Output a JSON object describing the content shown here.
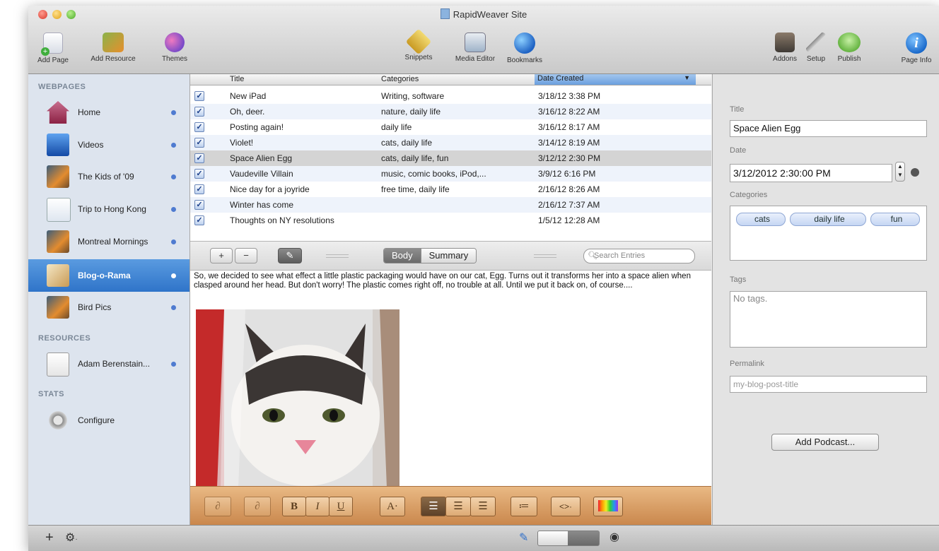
{
  "window": {
    "title": "RapidWeaver Site"
  },
  "toolbar": {
    "add_page": "Add Page",
    "add_resource": "Add Resource",
    "themes": "Themes",
    "snippets": "Snippets",
    "media_editor": "Media Editor",
    "bookmarks": "Bookmarks",
    "addons": "Addons",
    "setup": "Setup",
    "publish": "Publish",
    "page_info": "Page Info"
  },
  "sidebar": {
    "webpages_header": "WEBPAGES",
    "resources_header": "RESOURCES",
    "stats_header": "STATS",
    "pages": [
      {
        "label": "Home"
      },
      {
        "label": "Videos"
      },
      {
        "label": "The Kids of '09"
      },
      {
        "label": "Trip to Hong Kong"
      },
      {
        "label": "Montreal Mornings"
      },
      {
        "label": "Blog-o-Rama"
      },
      {
        "label": "Bird Pics"
      }
    ],
    "resources": [
      {
        "label": "Adam Berenstain..."
      }
    ],
    "stats": [
      {
        "label": "Configure"
      }
    ]
  },
  "table": {
    "columns": {
      "title": "Title",
      "categories": "Categories",
      "date": "Date Created"
    },
    "rows": [
      {
        "title": "New iPad",
        "categories": "Writing,  software",
        "date": "3/18/12 3:38 PM"
      },
      {
        "title": "Oh, deer.",
        "categories": "nature,  daily life",
        "date": "3/16/12 8:22 AM"
      },
      {
        "title": "Posting again!",
        "categories": "daily life",
        "date": "3/16/12 8:17 AM"
      },
      {
        "title": "Violet!",
        "categories": "cats,  daily life",
        "date": "3/14/12 8:19 AM"
      },
      {
        "title": "Space Alien Egg",
        "categories": "cats,  daily life,  fun",
        "date": "3/12/12 2:30 PM"
      },
      {
        "title": "Vaudeville Villain",
        "categories": "music,  comic books,  iPod,...",
        "date": "3/9/12 6:16 PM"
      },
      {
        "title": "Nice day for a joyride",
        "categories": "free time,  daily life",
        "date": "2/16/12 8:26 AM"
      },
      {
        "title": "Winter has come",
        "categories": "",
        "date": "2/16/12 7:37 AM"
      },
      {
        "title": "Thoughts on NY resolutions",
        "categories": "",
        "date": "1/5/12 12:28 AM"
      }
    ]
  },
  "editbar": {
    "add": "+",
    "remove": "−",
    "body_tab": "Body",
    "summary_tab": "Summary",
    "search_placeholder": "Search Entries"
  },
  "entry": {
    "body": "So, we decided to see what effect a little plastic packaging would have on our cat, Egg. Turns out it transforms her into a space alien when clasped around her head. But don't worry! The plastic comes right off, no trouble at all. Until we put it back on, of course...."
  },
  "format": {
    "bold": "B",
    "italic": "I",
    "underline": "U",
    "font": "A·",
    "code": "<>·"
  },
  "inspector": {
    "title_label": "Title",
    "title_value": "Space Alien Egg",
    "date_label": "Date",
    "date_value": "3/12/2012  2:30:00 PM",
    "categories_label": "Categories",
    "categories": [
      "cats",
      "daily life",
      "fun"
    ],
    "tags_label": "Tags",
    "tags_placeholder": "No tags.",
    "permalink_label": "Permalink",
    "permalink_placeholder": "my-blog-post-title",
    "add_podcast": "Add Podcast..."
  },
  "colors": {
    "selection": "#2f74c9",
    "sidebar_bg": "#dde4ee",
    "format_bar": "#d49a5f"
  }
}
